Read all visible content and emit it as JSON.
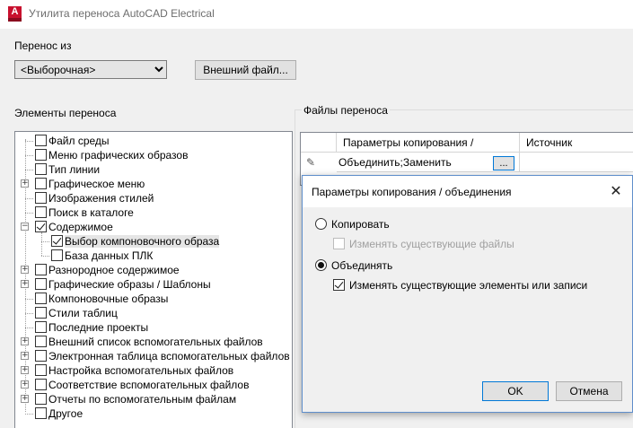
{
  "window": {
    "title": "Утилита переноса AutoCAD Electrical",
    "icon_letter": "A"
  },
  "transfer_from": {
    "label": "Перенос из",
    "selected": "<Выборочная>",
    "external_file_button": "Внешний файл..."
  },
  "elements": {
    "label": "Элементы переноса",
    "items": [
      {
        "label": "Файл среды",
        "checked": false,
        "expandable": false
      },
      {
        "label": "Меню графических образов",
        "checked": false,
        "expandable": false
      },
      {
        "label": "Тип линии",
        "checked": false,
        "expandable": false
      },
      {
        "label": "Графическое меню",
        "checked": false,
        "expandable": true
      },
      {
        "label": "Изображения стилей",
        "checked": false,
        "expandable": false
      },
      {
        "label": "Поиск в каталоге",
        "checked": false,
        "expandable": false
      },
      {
        "label": "Содержимое",
        "checked": true,
        "expandable": true,
        "expanded": true
      },
      {
        "label": "Выбор компоновочного образа",
        "checked": true,
        "child": true
      },
      {
        "label": "База данных ПЛК",
        "checked": false,
        "child": true
      },
      {
        "label": "Разнородное содержимое",
        "checked": false,
        "expandable": true
      },
      {
        "label": "Графические образы / Шаблоны",
        "checked": false,
        "expandable": true
      },
      {
        "label": "Компоновочные образы",
        "checked": false,
        "expandable": false
      },
      {
        "label": "Стили таблиц",
        "checked": false,
        "expandable": false
      },
      {
        "label": "Последние проекты",
        "checked": false,
        "expandable": false
      },
      {
        "label": "Внешний список вспомогательных файлов",
        "checked": false,
        "expandable": true
      },
      {
        "label": "Электронная таблица вспомогательных файлов",
        "checked": false,
        "expandable": true
      },
      {
        "label": "Настройка вспомогательных файлов",
        "checked": false,
        "expandable": true
      },
      {
        "label": "Соответствие вспомогательных файлов",
        "checked": false,
        "expandable": true
      },
      {
        "label": "Отчеты по вспомогательным файлам",
        "checked": false,
        "expandable": true
      },
      {
        "label": "Другое",
        "checked": false,
        "expandable": false
      }
    ]
  },
  "transfer_files": {
    "label": "Файлы переноса",
    "columns": [
      "Параметры копирования /",
      "Источник"
    ],
    "row": {
      "copy_params": "Объединить;Заменить",
      "ellipsis": "..."
    }
  },
  "dialog": {
    "title": "Параметры копирования / объединения",
    "close": "✕",
    "copy_label": "Копировать",
    "copy_checked": false,
    "change_existing_files": "Изменять существующие файлы",
    "merge_label": "Объединять",
    "merge_checked": true,
    "change_existing_elements": "Изменять существующие элементы или записи",
    "ok": "OK",
    "cancel": "Отмена"
  },
  "colors": {
    "accent_border": "#0078d7",
    "app_icon": "#c8102e"
  }
}
